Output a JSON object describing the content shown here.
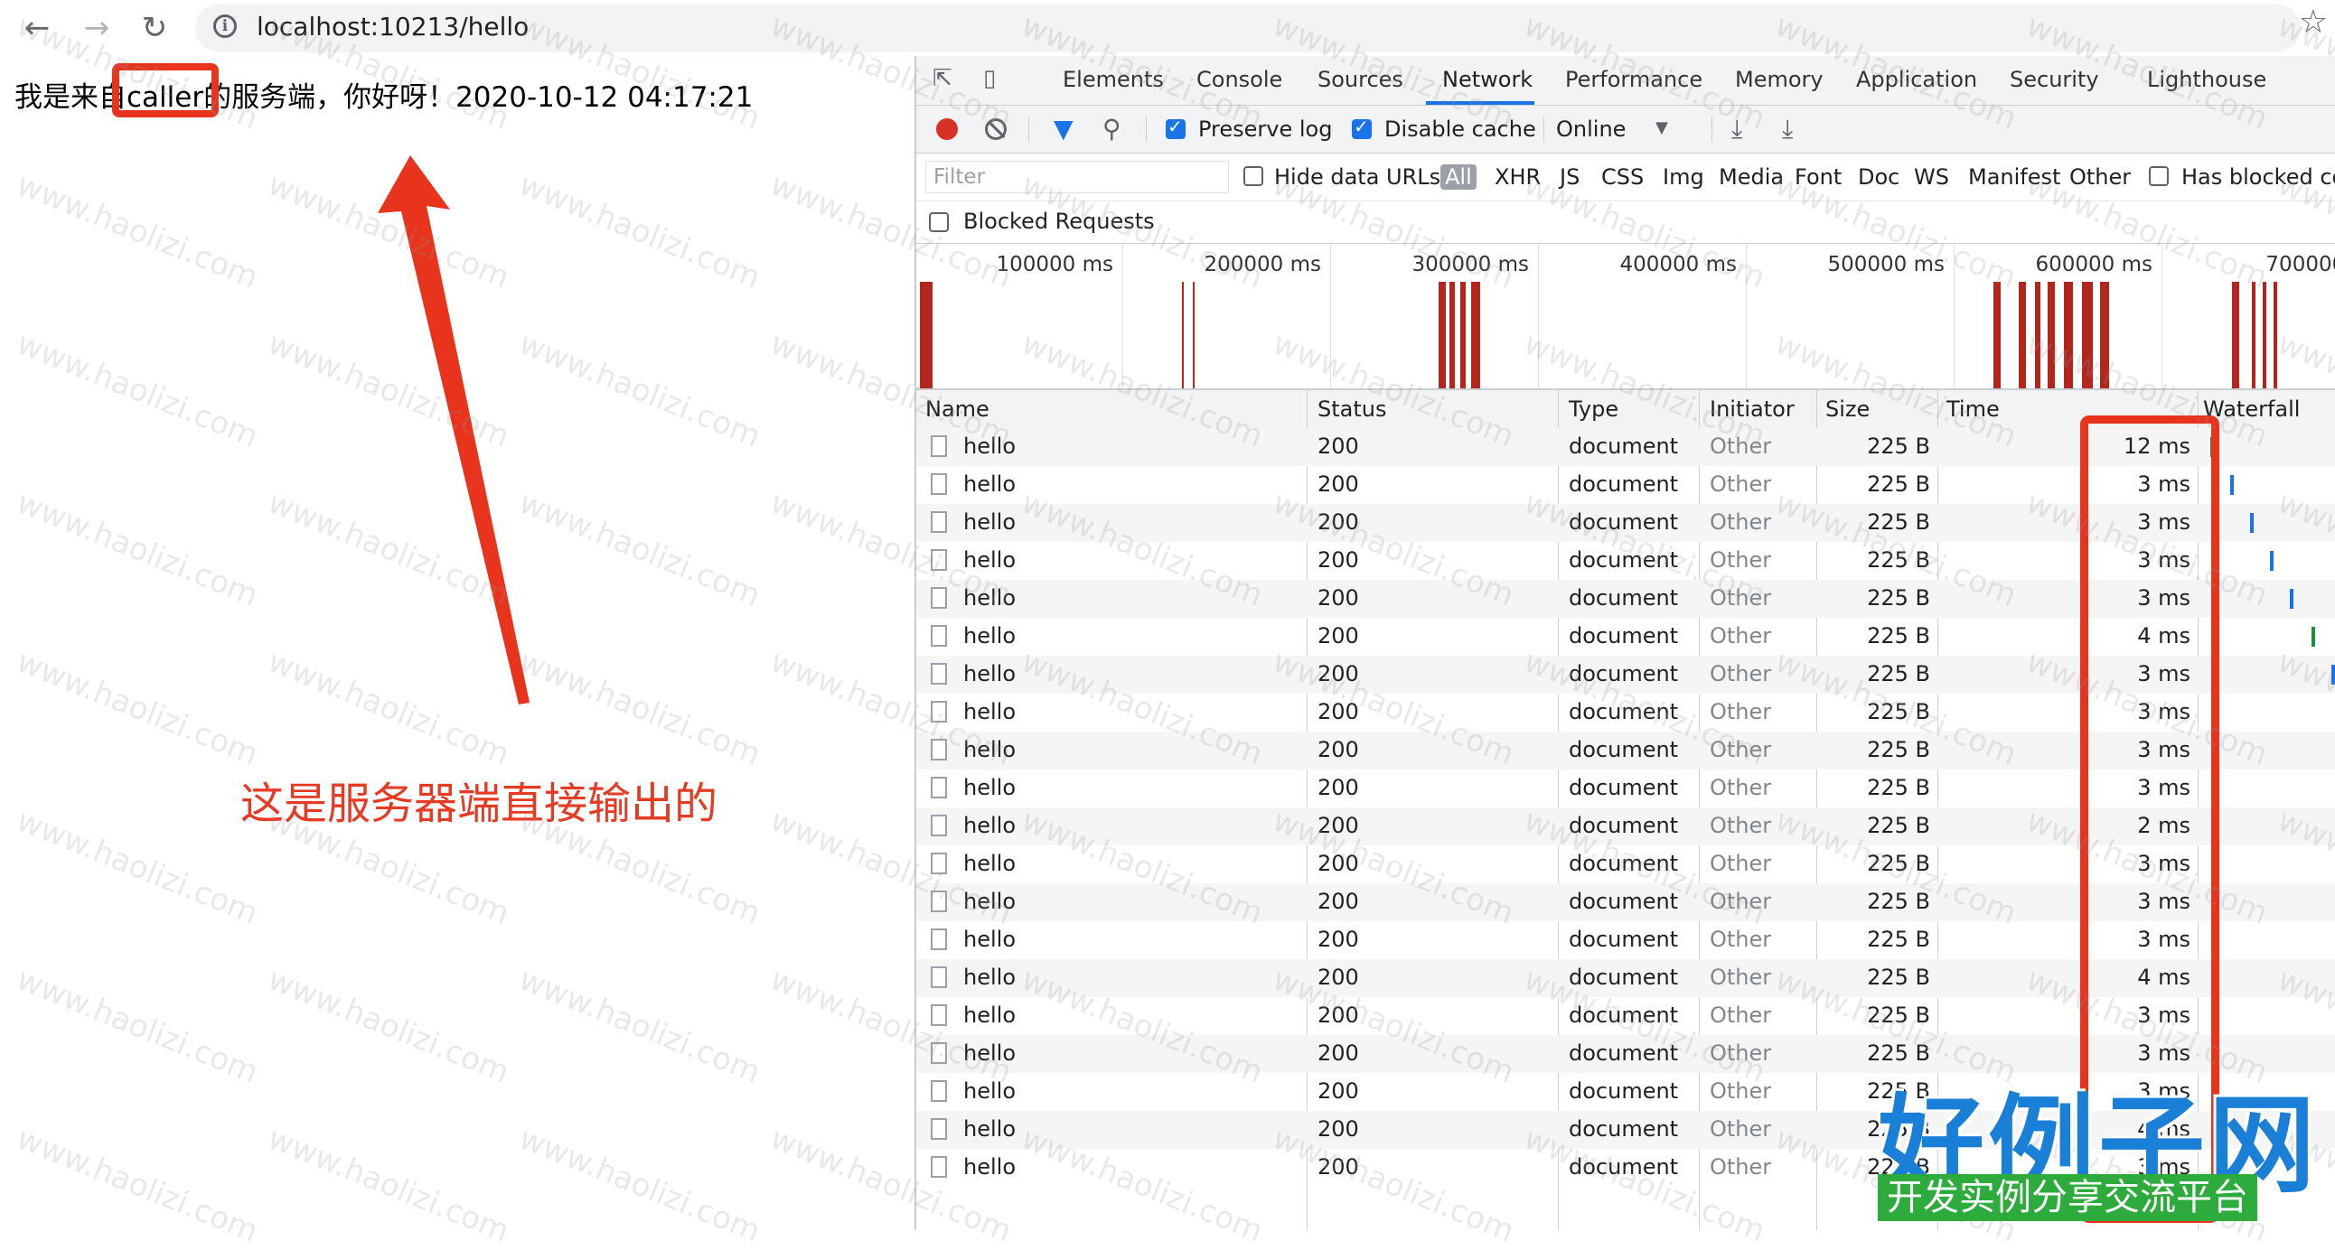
{
  "browser": {
    "url": "localhost:10213/hello"
  },
  "page": {
    "text": "我是来自caller的服务端，你好呀！2020-10-12 04:17:21",
    "annotation": "这是服务器端直接输出的"
  },
  "devtools": {
    "tabs": [
      "Elements",
      "Console",
      "Sources",
      "Network",
      "Performance",
      "Memory",
      "Application",
      "Security",
      "Lighthouse"
    ],
    "active_tab": "Network",
    "toolbar": {
      "preserve_log": "Preserve log",
      "disable_cache": "Disable cache",
      "throttling": "Online"
    },
    "filter": {
      "placeholder": "Filter",
      "hide_data_urls": "Hide data URLs",
      "types": [
        "All",
        "XHR",
        "JS",
        "CSS",
        "Img",
        "Media",
        "Font",
        "Doc",
        "WS",
        "Manifest",
        "Other"
      ],
      "has_blocked": "Has blocked co",
      "blocked_requests": "Blocked Requests"
    },
    "overview_ticks": [
      "100000 ms",
      "200000 ms",
      "300000 ms",
      "400000 ms",
      "500000 ms",
      "600000 ms",
      "700000 r"
    ],
    "columns": [
      "Name",
      "Status",
      "Type",
      "Initiator",
      "Size",
      "Time",
      "Waterfall"
    ],
    "requests": [
      {
        "name": "hello",
        "status": "200",
        "type": "document",
        "initiator": "Other",
        "size": "225 B",
        "time": "12 ms"
      },
      {
        "name": "hello",
        "status": "200",
        "type": "document",
        "initiator": "Other",
        "size": "225 B",
        "time": "3 ms"
      },
      {
        "name": "hello",
        "status": "200",
        "type": "document",
        "initiator": "Other",
        "size": "225 B",
        "time": "3 ms"
      },
      {
        "name": "hello",
        "status": "200",
        "type": "document",
        "initiator": "Other",
        "size": "225 B",
        "time": "3 ms"
      },
      {
        "name": "hello",
        "status": "200",
        "type": "document",
        "initiator": "Other",
        "size": "225 B",
        "time": "3 ms"
      },
      {
        "name": "hello",
        "status": "200",
        "type": "document",
        "initiator": "Other",
        "size": "225 B",
        "time": "4 ms"
      },
      {
        "name": "hello",
        "status": "200",
        "type": "document",
        "initiator": "Other",
        "size": "225 B",
        "time": "3 ms"
      },
      {
        "name": "hello",
        "status": "200",
        "type": "document",
        "initiator": "Other",
        "size": "225 B",
        "time": "3 ms"
      },
      {
        "name": "hello",
        "status": "200",
        "type": "document",
        "initiator": "Other",
        "size": "225 B",
        "time": "3 ms"
      },
      {
        "name": "hello",
        "status": "200",
        "type": "document",
        "initiator": "Other",
        "size": "225 B",
        "time": "3 ms"
      },
      {
        "name": "hello",
        "status": "200",
        "type": "document",
        "initiator": "Other",
        "size": "225 B",
        "time": "2 ms"
      },
      {
        "name": "hello",
        "status": "200",
        "type": "document",
        "initiator": "Other",
        "size": "225 B",
        "time": "3 ms"
      },
      {
        "name": "hello",
        "status": "200",
        "type": "document",
        "initiator": "Other",
        "size": "225 B",
        "time": "3 ms"
      },
      {
        "name": "hello",
        "status": "200",
        "type": "document",
        "initiator": "Other",
        "size": "225 B",
        "time": "3 ms"
      },
      {
        "name": "hello",
        "status": "200",
        "type": "document",
        "initiator": "Other",
        "size": "225 B",
        "time": "4 ms"
      },
      {
        "name": "hello",
        "status": "200",
        "type": "document",
        "initiator": "Other",
        "size": "225 B",
        "time": "3 ms"
      },
      {
        "name": "hello",
        "status": "200",
        "type": "document",
        "initiator": "Other",
        "size": "225 B",
        "time": "3 ms"
      },
      {
        "name": "hello",
        "status": "200",
        "type": "document",
        "initiator": "Other",
        "size": "225 B",
        "time": "3 ms"
      },
      {
        "name": "hello",
        "status": "200",
        "type": "document",
        "initiator": "Other",
        "size": "225 B",
        "time": "4 ms"
      },
      {
        "name": "hello",
        "status": "200",
        "type": "document",
        "initiator": "Other",
        "size": "225 B",
        "time": "3 ms"
      }
    ]
  },
  "watermark": {
    "text": "www.haolizi.com",
    "logo": "好例子网",
    "logo_sub": "开发实例分享交流平台"
  },
  "colors": {
    "annotation_red": "#e8341c",
    "devtools_blue": "#1a73e8",
    "record_red": "#d93025",
    "overview_bar": "#b3261e"
  }
}
